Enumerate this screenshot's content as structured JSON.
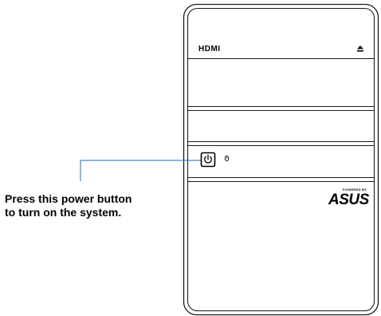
{
  "case": {
    "hdmi_logo_text": "HDMI",
    "eject_icon": "eject-icon",
    "power_icon": "power-icon",
    "led_icon": "hdd-led-icon",
    "brand_powered_by": "POWERED BY",
    "brand_name": "ASUS"
  },
  "callout": {
    "line1": "Press this power button",
    "line2": "to turn on the system.",
    "color": "#1a6fc0"
  }
}
